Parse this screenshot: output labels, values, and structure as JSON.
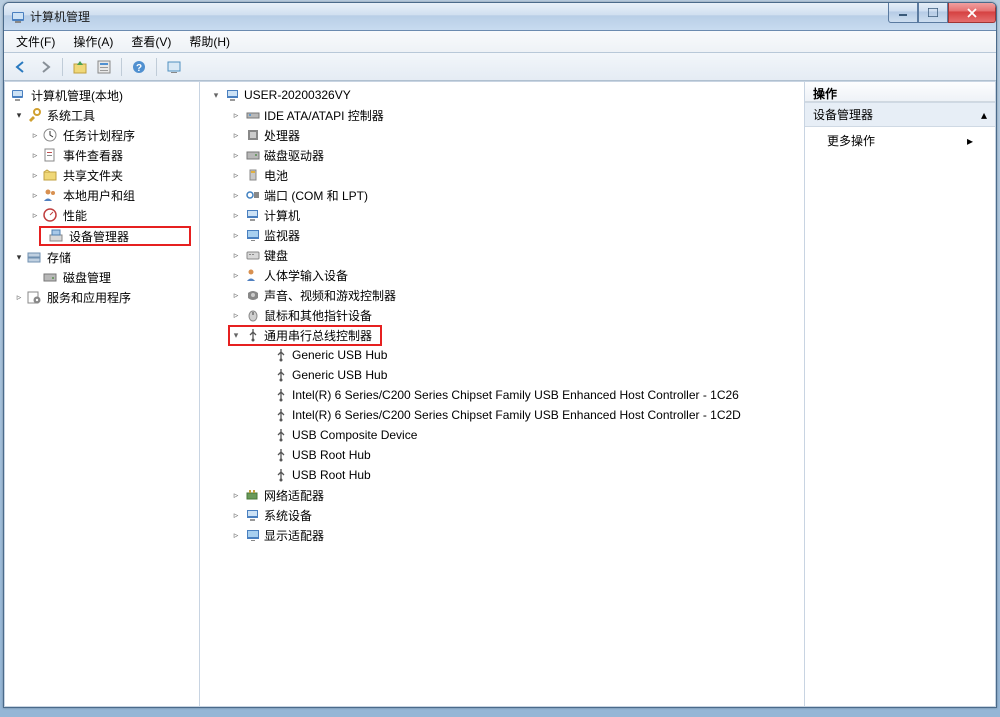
{
  "window": {
    "title": "计算机管理"
  },
  "menus": [
    "文件(F)",
    "操作(A)",
    "查看(V)",
    "帮助(H)"
  ],
  "leftTree": {
    "root": "计算机管理(本地)",
    "sysTools": "系统工具",
    "sysToolsChildren": [
      "任务计划程序",
      "事件查看器",
      "共享文件夹",
      "本地用户和组",
      "性能"
    ],
    "deviceManager": "设备管理器",
    "storage": "存储",
    "diskMgmt": "磁盘管理",
    "services": "服务和应用程序"
  },
  "deviceRoot": "USER-20200326VY",
  "deviceCategories": [
    "IDE ATA/ATAPI 控制器",
    "处理器",
    "磁盘驱动器",
    "电池",
    "端口 (COM 和 LPT)",
    "计算机",
    "监视器",
    "键盘",
    "人体学输入设备",
    "声音、视频和游戏控制器",
    "鼠标和其他指针设备"
  ],
  "usbCategory": "通用串行总线控制器",
  "usbDevices": [
    "Generic USB Hub",
    "Generic USB Hub",
    "Intel(R) 6 Series/C200 Series Chipset Family USB Enhanced Host Controller - 1C26",
    "Intel(R) 6 Series/C200 Series Chipset Family USB Enhanced Host Controller - 1C2D",
    "USB Composite Device",
    "USB Root Hub",
    "USB Root Hub"
  ],
  "afterCategories": [
    "网络适配器",
    "系统设备",
    "显示适配器"
  ],
  "rightPanel": {
    "header": "操作",
    "section": "设备管理器",
    "moreActions": "更多操作"
  }
}
